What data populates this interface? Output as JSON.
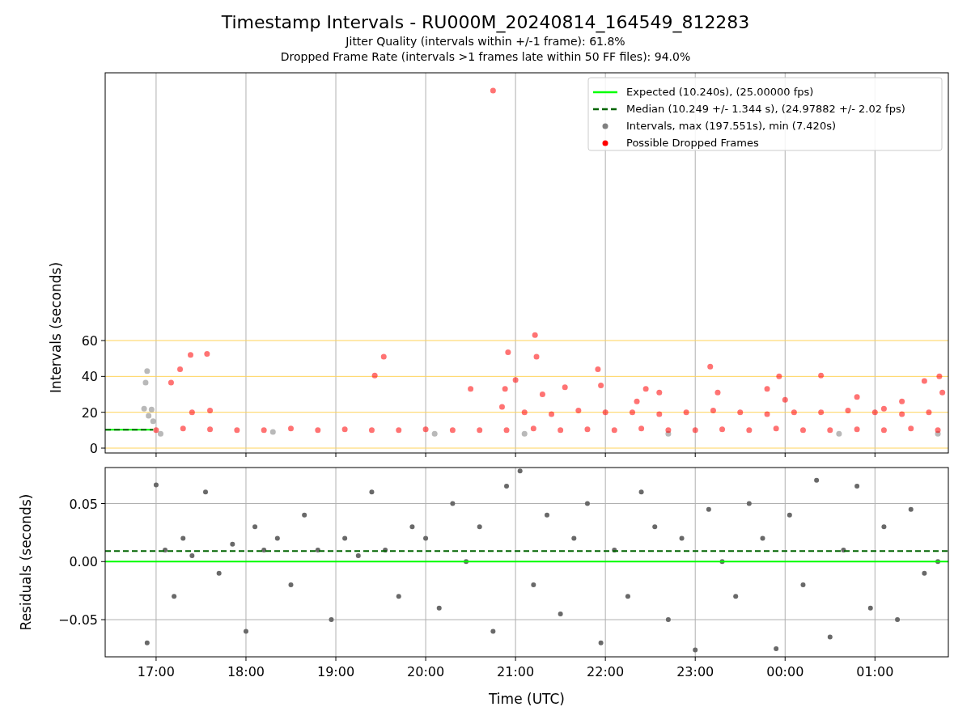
{
  "title": "Timestamp Intervals - RU000M_20240814_164549_812283",
  "subtitles": [
    "Jitter Quality (intervals within +/-1 frame): 61.8%",
    "Dropped Frame Rate (intervals >1 frames late within 50 FF files): 94.0%"
  ],
  "intervals_chart": {
    "chart_data": {
      "type": "scatter",
      "ylabel": "Intervals (seconds)",
      "grid": true,
      "xlim": [
        "2024-08-14T16:26",
        "2024-08-15T01:49"
      ],
      "ylim": [
        -2.7,
        209.3
      ],
      "yticks": [
        {
          "value": 0,
          "label": "0"
        },
        {
          "value": 20,
          "label": "20"
        },
        {
          "value": 40,
          "label": "40"
        },
        {
          "value": 60,
          "label": "60"
        }
      ],
      "legend": "upper right",
      "series": [
        {
          "name": "Expected (10.240s), (25.00000 fps)",
          "type": "line",
          "line_style": "solid",
          "color": "#00ff00",
          "x": [
            "2024-08-14T16:26",
            "2024-08-14T16:58"
          ],
          "values": [
            10.24,
            10.24
          ]
        },
        {
          "name": "Median (10.249 +/- 1.344 s), (24.97882 +/- 2.02 fps)",
          "type": "line",
          "line_style": "dashed",
          "color": "#006400",
          "x": [
            "2024-08-14T16:26",
            "2024-08-14T16:58"
          ],
          "values": [
            10.249,
            10.249
          ]
        },
        {
          "name": "Intervals, max (197.551s), min (7.420s)",
          "type": "scatter",
          "color": "#808080",
          "x": [
            "2024-08-14T16:52",
            "2024-08-14T16:53",
            "2024-08-14T16:54",
            "2024-08-14T16:55",
            "2024-08-14T16:57",
            "2024-08-14T16:58",
            "2024-08-14T17:03",
            "2024-08-14T18:18",
            "2024-08-14T20:06",
            "2024-08-14T21:06",
            "2024-08-14T22:42",
            "2024-08-15T00:36",
            "2024-08-15T01:42"
          ],
          "values": [
            22,
            36.5,
            43,
            18,
            21.5,
            15,
            8,
            9,
            8,
            8,
            8,
            8,
            8
          ]
        },
        {
          "name": "Possible Dropped Frames",
          "type": "scatter",
          "color": "#ff0000",
          "x": [
            "2024-08-14T17:10",
            "2024-08-14T17:16",
            "2024-08-14T17:23",
            "2024-08-14T17:34",
            "2024-08-14T17:36",
            "2024-08-14T17:24",
            "2024-08-14T19:26",
            "2024-08-14T19:32",
            "2024-08-14T20:30",
            "2024-08-14T20:45",
            "2024-08-14T20:51",
            "2024-08-14T20:53",
            "2024-08-14T20:55",
            "2024-08-14T21:00",
            "2024-08-14T21:13",
            "2024-08-14T21:14",
            "2024-08-14T21:18",
            "2024-08-14T21:33",
            "2024-08-14T21:55",
            "2024-08-14T21:57",
            "2024-08-14T22:21",
            "2024-08-14T22:27",
            "2024-08-14T22:36",
            "2024-08-14T23:10",
            "2024-08-14T23:15",
            "2024-08-14T23:48",
            "2024-08-14T23:56",
            "2024-08-15T00:00",
            "2024-08-15T00:24",
            "2024-08-15T00:48",
            "2024-08-15T01:06",
            "2024-08-15T01:18",
            "2024-08-15T01:33",
            "2024-08-15T01:43",
            "2024-08-15T01:45",
            "2024-08-14T17:00",
            "2024-08-14T17:18",
            "2024-08-14T17:36",
            "2024-08-14T17:54",
            "2024-08-14T18:12",
            "2024-08-14T18:30",
            "2024-08-14T18:48",
            "2024-08-14T19:06",
            "2024-08-14T19:24",
            "2024-08-14T19:42",
            "2024-08-14T20:00",
            "2024-08-14T20:18",
            "2024-08-14T20:36",
            "2024-08-14T20:54",
            "2024-08-14T21:12",
            "2024-08-14T21:30",
            "2024-08-14T21:48",
            "2024-08-14T22:06",
            "2024-08-14T22:24",
            "2024-08-14T22:42",
            "2024-08-14T23:00",
            "2024-08-14T23:18",
            "2024-08-14T23:36",
            "2024-08-14T23:54",
            "2024-08-15T00:12",
            "2024-08-15T00:30",
            "2024-08-15T00:48",
            "2024-08-15T01:06",
            "2024-08-15T01:24",
            "2024-08-15T01:42",
            "2024-08-14T21:06",
            "2024-08-14T21:24",
            "2024-08-14T21:42",
            "2024-08-14T22:00",
            "2024-08-14T22:18",
            "2024-08-14T22:36",
            "2024-08-14T22:54",
            "2024-08-14T23:12",
            "2024-08-14T23:30",
            "2024-08-14T23:48",
            "2024-08-15T00:06",
            "2024-08-15T00:24",
            "2024-08-15T00:42",
            "2024-08-15T01:00",
            "2024-08-15T01:18",
            "2024-08-15T01:36"
          ],
          "values": [
            36.5,
            44,
            52,
            52.5,
            21,
            20,
            40.5,
            51,
            33,
            199.4,
            23,
            33,
            53.5,
            38,
            63,
            51,
            30,
            34,
            44,
            35,
            26,
            33,
            31,
            45.5,
            31,
            33,
            40,
            27,
            40.5,
            28.5,
            22,
            26,
            37.5,
            40,
            31,
            10,
            11,
            10.5,
            10,
            10,
            11,
            10,
            10.5,
            10,
            10,
            10.5,
            10,
            10,
            10,
            11,
            10,
            10.5,
            10,
            11,
            10,
            10,
            10.5,
            10,
            11,
            10,
            10,
            10.5,
            10,
            11,
            10,
            20,
            19,
            21,
            20,
            20,
            19,
            20,
            21,
            20,
            19,
            20,
            20,
            21,
            20,
            19,
            20
          ]
        }
      ]
    }
  },
  "residuals_chart": {
    "chart_data": {
      "type": "scatter",
      "xlabel": "Time (UTC)",
      "ylabel": "Residuals (seconds)",
      "grid": true,
      "xlim": [
        "2024-08-14T16:26",
        "2024-08-15T01:49"
      ],
      "ylim": [
        -0.082,
        0.081
      ],
      "xticks": [
        {
          "value": "2024-08-14T17:00",
          "label": "17:00"
        },
        {
          "value": "2024-08-14T18:00",
          "label": "18:00"
        },
        {
          "value": "2024-08-14T19:00",
          "label": "19:00"
        },
        {
          "value": "2024-08-14T20:00",
          "label": "20:00"
        },
        {
          "value": "2024-08-14T21:00",
          "label": "21:00"
        },
        {
          "value": "2024-08-14T22:00",
          "label": "22:00"
        },
        {
          "value": "2024-08-14T23:00",
          "label": "23:00"
        },
        {
          "value": "2024-08-15T00:00",
          "label": "00:00"
        },
        {
          "value": "2024-08-15T01:00",
          "label": "01:00"
        }
      ],
      "yticks": [
        {
          "value": -0.05,
          "label": "−0.05"
        },
        {
          "value": 0,
          "label": "0.00"
        },
        {
          "value": 0.05,
          "label": "0.05"
        }
      ],
      "series": [
        {
          "type": "line",
          "line_style": "solid",
          "color": "#00ff00",
          "x": [
            "2024-08-14T16:26",
            "2024-08-15T01:49"
          ],
          "values": [
            0,
            0
          ]
        },
        {
          "type": "line",
          "line_style": "dashed",
          "color": "#006400",
          "x": [
            "2024-08-14T16:26",
            "2024-08-15T01:49"
          ],
          "values": [
            0.009,
            0.009
          ]
        },
        {
          "type": "scatter",
          "color": "#696969",
          "x": [
            "2024-08-14T16:54",
            "2024-08-14T17:00",
            "2024-08-14T17:06",
            "2024-08-14T17:12",
            "2024-08-14T17:18",
            "2024-08-14T17:24",
            "2024-08-14T17:33",
            "2024-08-14T17:42",
            "2024-08-14T17:51",
            "2024-08-14T18:00",
            "2024-08-14T18:06",
            "2024-08-14T18:12",
            "2024-08-14T18:21",
            "2024-08-14T18:30",
            "2024-08-14T18:39",
            "2024-08-14T18:48",
            "2024-08-14T18:57",
            "2024-08-14T19:06",
            "2024-08-14T19:15",
            "2024-08-14T19:24",
            "2024-08-14T19:33",
            "2024-08-14T19:42",
            "2024-08-14T19:51",
            "2024-08-14T20:00",
            "2024-08-14T20:09",
            "2024-08-14T20:18",
            "2024-08-14T20:27",
            "2024-08-14T20:36",
            "2024-08-14T20:45",
            "2024-08-14T20:54",
            "2024-08-14T21:03",
            "2024-08-14T21:12",
            "2024-08-14T21:21",
            "2024-08-14T21:30",
            "2024-08-14T21:39",
            "2024-08-14T21:48",
            "2024-08-14T21:57",
            "2024-08-14T22:06",
            "2024-08-14T22:15",
            "2024-08-14T22:24",
            "2024-08-14T22:33",
            "2024-08-14T22:42",
            "2024-08-14T22:51",
            "2024-08-14T23:00",
            "2024-08-14T23:09",
            "2024-08-14T23:18",
            "2024-08-14T23:27",
            "2024-08-14T23:36",
            "2024-08-14T23:45",
            "2024-08-14T23:54",
            "2024-08-15T00:03",
            "2024-08-15T00:12",
            "2024-08-15T00:21",
            "2024-08-15T00:30",
            "2024-08-15T00:39",
            "2024-08-15T00:48",
            "2024-08-15T00:57",
            "2024-08-15T01:06",
            "2024-08-15T01:15",
            "2024-08-15T01:24",
            "2024-08-15T01:33",
            "2024-08-15T01:42"
          ],
          "values": [
            -0.07,
            0.066,
            0.01,
            -0.03,
            0.02,
            0.005,
            0.06,
            -0.01,
            0.015,
            -0.06,
            0.03,
            0.01,
            0.02,
            -0.02,
            0.04,
            0.01,
            -0.05,
            0.02,
            0.005,
            0.06,
            0.01,
            -0.03,
            0.03,
            0.02,
            -0.04,
            0.05,
            0.0,
            0.03,
            -0.06,
            0.065,
            0.078,
            -0.02,
            0.04,
            -0.045,
            0.02,
            0.05,
            -0.07,
            0.01,
            -0.03,
            0.06,
            0.03,
            -0.05,
            0.02,
            -0.076,
            0.045,
            0.0,
            -0.03,
            0.05,
            0.02,
            -0.075,
            0.04,
            -0.02,
            0.07,
            -0.065,
            0.01,
            0.065,
            -0.04,
            0.03,
            -0.05,
            0.045,
            -0.01,
            0.0
          ]
        }
      ]
    }
  }
}
